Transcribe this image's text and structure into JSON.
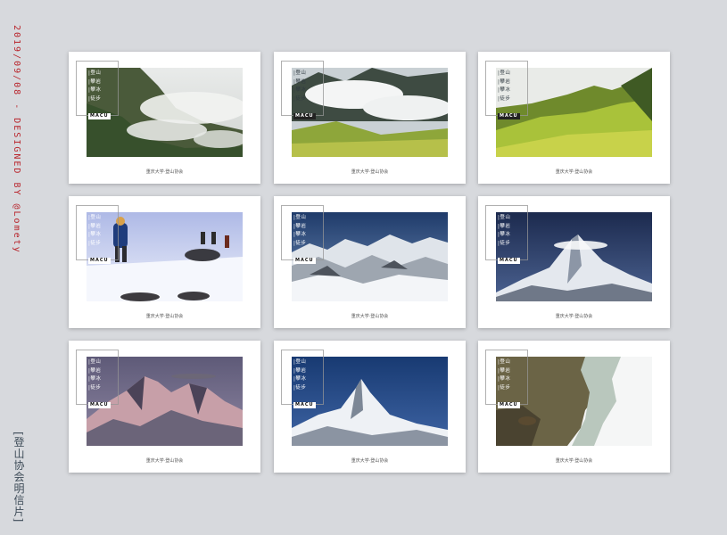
{
  "sidebar": {
    "date_credit": "2019/09/08 - DESIGNED BY @Lomety",
    "title": "[登山协会明信片]"
  },
  "tag": {
    "lines": [
      "|登山",
      "|攀岩",
      "|攀冰",
      "|徒步"
    ],
    "logo": "MACU"
  },
  "postcards": [
    {
      "caption": "重庆大学·登山协会",
      "scene": "misty forested hillside with clouds"
    },
    {
      "caption": "重庆大学·登山协会",
      "scene": "cloud-covered valley with green meadow"
    },
    {
      "caption": "重庆大学·登山协会",
      "scene": "golden-green grassy slopes under pale sky"
    },
    {
      "caption": "重庆大学·登山协会",
      "scene": "climbers hiking across a snowfield"
    },
    {
      "caption": "重庆大学·登山协会",
      "scene": "snowy mountain range under blue sky"
    },
    {
      "caption": "重庆大学·登山协会",
      "scene": "snow peak with cloud at summit"
    },
    {
      "caption": "重庆大学·登山协会",
      "scene": "pink-lit snowy peaks at dusk"
    },
    {
      "caption": "重庆大学·登山协会",
      "scene": "sharp snow pyramid peak under deep blue sky"
    },
    {
      "caption": "重庆大学·登山协会",
      "scene": "rock cliff with snowy ridge and bird of prey"
    }
  ]
}
